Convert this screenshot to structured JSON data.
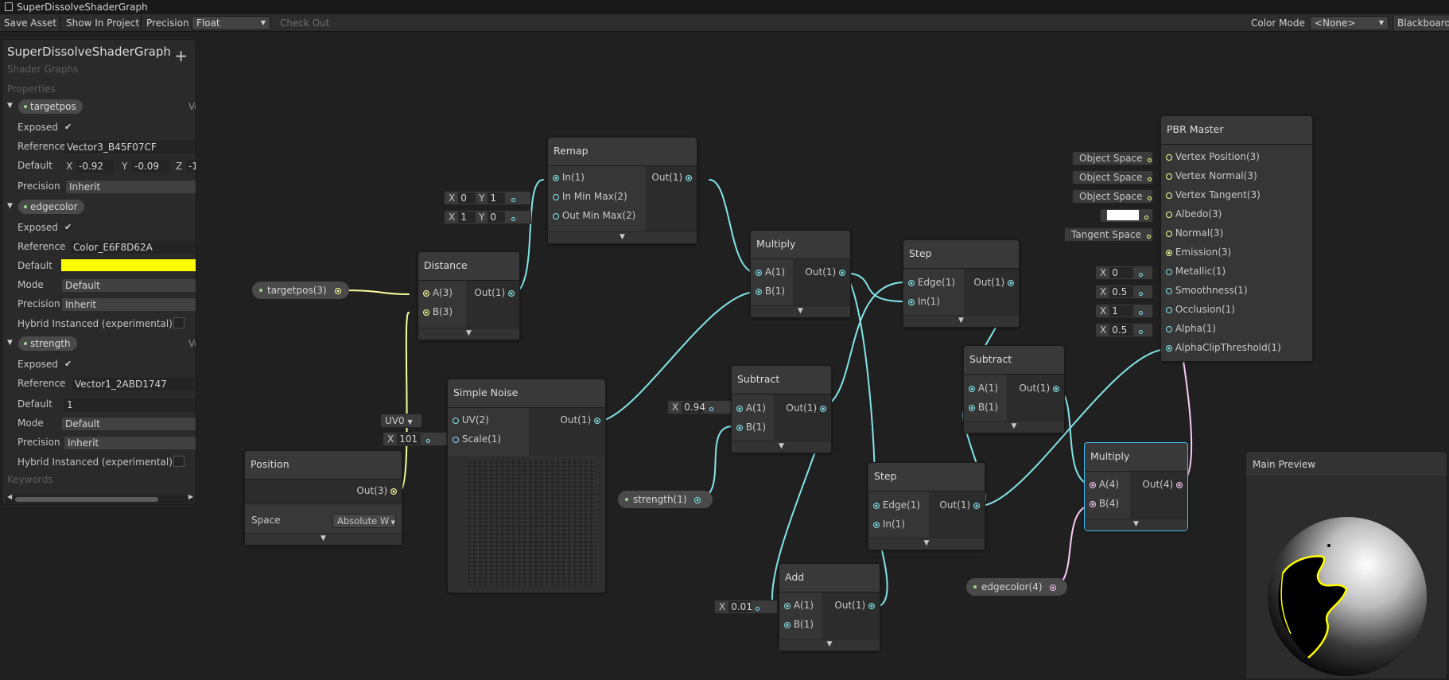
{
  "window": {
    "title": "SuperDissolveShaderGraph"
  },
  "toolbar": {
    "save_asset": "Save Asset",
    "show_in_project": "Show In Project",
    "precision_label": "Precision",
    "precision_value": "Float",
    "check_out": "Check Out",
    "color_mode_label": "Color Mode",
    "color_mode_value": "<None>",
    "blackboard": "Blackboard"
  },
  "blackboard": {
    "title": "SuperDissolveShaderGraph",
    "subtitle": "Shader Graphs",
    "add": "+",
    "properties_label": "Properties",
    "keywords_label": "Keywords",
    "targetpos": {
      "name": "targetpos",
      "ve": "Ve",
      "exposed_label": "Exposed",
      "reference_label": "Reference",
      "reference": "Vector3_B45F07CF",
      "default_label": "Default",
      "x_label": "X",
      "x": "-0.92",
      "y_label": "Y",
      "y": "-0.09",
      "z_label": "Z",
      "z": "-1",
      "precision_label": "Precision",
      "precision": "Inherit"
    },
    "edgecolor": {
      "name": "edgecolor",
      "exposed_label": "Exposed",
      "reference_label": "Reference",
      "reference": "Color_E6F8D62A",
      "default_label": "Default",
      "default_color": "#ffff00",
      "mode_label": "Mode",
      "mode": "Default",
      "precision_label": "Precision",
      "precision": "Inherit",
      "hybrid_label": "Hybrid Instanced (experimental)"
    },
    "strength": {
      "name": "strength",
      "ve": "Ve",
      "exposed_label": "Exposed",
      "reference_label": "Reference",
      "reference": "Vector1_2ABD1747",
      "default_label": "Default",
      "default": "1",
      "mode_label": "Mode",
      "mode": "Default",
      "precision_label": "Precision",
      "precision": "Inherit",
      "hybrid_label": "Hybrid Instanced (experimental)"
    }
  },
  "nodes": {
    "remap": {
      "title": "Remap",
      "in": "In(1)",
      "inminmax": "In Min Max(2)",
      "outminmax": "Out Min Max(2)",
      "out": "Out(1)",
      "in_x_label": "X",
      "in_x": "0",
      "in_y_label": "Y",
      "in_y": "1",
      "out_x_label": "X",
      "out_x": "1",
      "out_y_label": "Y",
      "out_y": "0"
    },
    "distance": {
      "title": "Distance",
      "a": "A(3)",
      "b": "B(3)",
      "out": "Out(1)"
    },
    "targetpos_prop": {
      "label": "targetpos(3)"
    },
    "multiply1": {
      "title": "Multiply",
      "a": "A(1)",
      "b": "B(1)",
      "out": "Out(1)"
    },
    "step1": {
      "title": "Step",
      "edge": "Edge(1)",
      "in": "In(1)",
      "out": "Out(1)"
    },
    "simple_noise": {
      "title": "Simple Noise",
      "uv": "UV(2)",
      "scale": "Scale(1)",
      "out": "Out(1)",
      "uv_value": "UV0",
      "scale_x_label": "X",
      "scale_value": "101"
    },
    "position": {
      "title": "Position",
      "out": "Out(3)",
      "space_label": "Space",
      "space_value": "Absolute W"
    },
    "subtract1": {
      "title": "Subtract",
      "a": "A(1)",
      "b": "B(1)",
      "out": "Out(1)",
      "a_x_label": "X",
      "a_value": "0.94"
    },
    "strength_prop": {
      "label": "strength(1)"
    },
    "subtract2": {
      "title": "Subtract",
      "a": "A(1)",
      "b": "B(1)",
      "out": "Out(1)"
    },
    "step2": {
      "title": "Step",
      "edge": "Edge(1)",
      "in": "In(1)",
      "out": "Out(1)"
    },
    "add": {
      "title": "Add",
      "a": "A(1)",
      "b": "B(1)",
      "out": "Out(1)",
      "a_x_label": "X",
      "a_value": "0.01"
    },
    "multiply2": {
      "title": "Multiply",
      "a": "A(4)",
      "b": "B(4)",
      "out": "Out(4)"
    },
    "edgecolor_prop": {
      "label": "edgecolor(4)"
    },
    "pbr": {
      "title": "PBR Master",
      "ports": [
        "Vertex Position(3)",
        "Vertex Normal(3)",
        "Vertex Tangent(3)",
        "Albedo(3)",
        "Normal(3)",
        "Emission(3)",
        "Metallic(1)",
        "Smoothness(1)",
        "Occlusion(1)",
        "Alpha(1)",
        "AlphaClipThreshold(1)"
      ],
      "vp_space": "Object Space",
      "vn_space": "Object Space",
      "vt_space": "Object Space",
      "albedo_color": "#ffffff",
      "normal_space": "Tangent Space",
      "metallic_x_label": "X",
      "metallic": "0",
      "smoothness_x_label": "X",
      "smoothness": "0.5",
      "occlusion_x_label": "X",
      "occlusion": "1",
      "alpha_x_label": "X",
      "alpha": "0.5"
    }
  },
  "preview": {
    "title": "Main Preview"
  },
  "colors": {
    "vec1": "#84e4e7",
    "vec3": "#f6ff9a",
    "vec4": "#fbcbf4",
    "edge": "#ffff00"
  }
}
